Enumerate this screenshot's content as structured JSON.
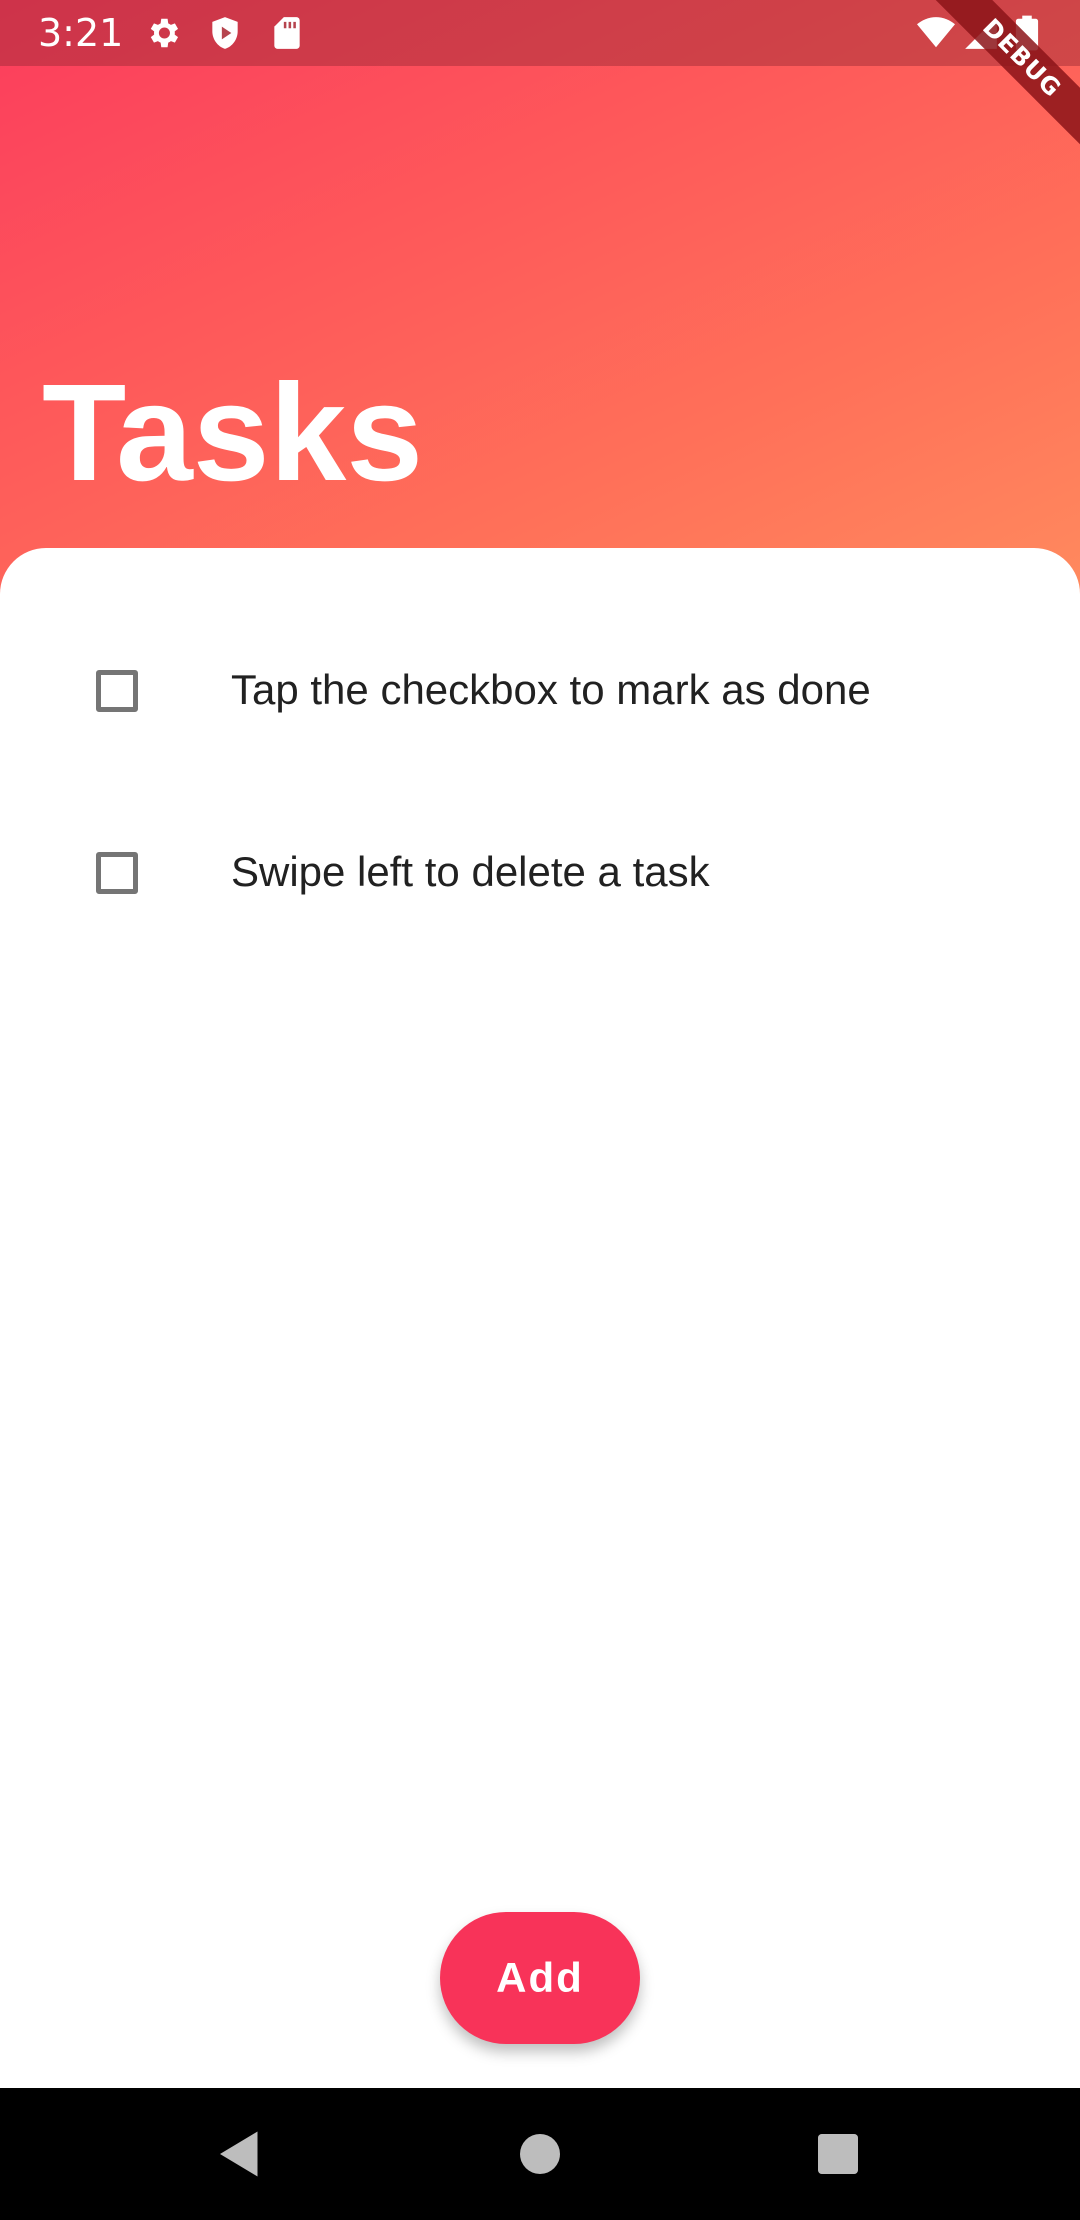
{
  "status_bar": {
    "time": "3:21",
    "icons": [
      "settings-icon",
      "play-protect-icon",
      "sd-card-icon",
      "wifi-icon",
      "signal-icon",
      "battery-icon"
    ]
  },
  "debug_banner": {
    "label": "DEBUG"
  },
  "header": {
    "title": "Tasks",
    "gradient_colors": [
      "#fb3c5d",
      "#ff8a5e"
    ]
  },
  "tasks": [
    {
      "label": "Tap the checkbox to mark as done",
      "checked": false
    },
    {
      "label": "Swipe left to delete a task",
      "checked": false
    }
  ],
  "add_button": {
    "label": "Add",
    "color": "#f83359"
  },
  "nav_bar": {
    "buttons": [
      "back-icon",
      "home-icon",
      "recents-icon"
    ]
  }
}
